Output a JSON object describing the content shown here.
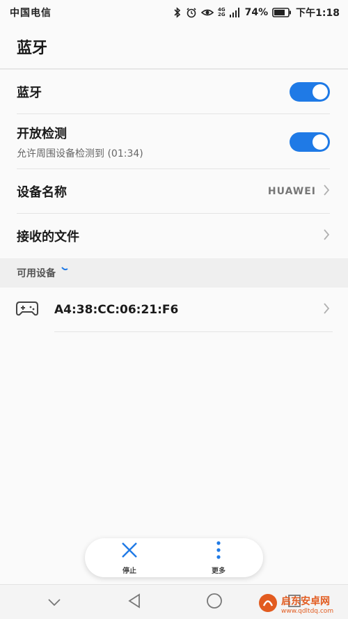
{
  "status_bar": {
    "carrier": "中国电信",
    "net_top": "4G",
    "net_bottom": "2G",
    "battery": "74%",
    "time": "下午1:18"
  },
  "header": {
    "title": "蓝牙"
  },
  "settings": {
    "bluetooth": {
      "label": "蓝牙",
      "enabled": true
    },
    "discoverable": {
      "label": "开放检测",
      "sub": "允许周围设备检测到 (01:34)",
      "enabled": true
    },
    "device_name": {
      "label": "设备名称",
      "value": "HUAWEI"
    },
    "received_files": {
      "label": "接收的文件"
    }
  },
  "available": {
    "section_label": "可用设备",
    "devices": [
      {
        "name": "A4:38:CC:06:21:F6",
        "icon": "gamepad-icon"
      }
    ]
  },
  "actions": {
    "stop": "停止",
    "more": "更多"
  },
  "watermark": {
    "cn": "启东安卓网",
    "url": "www.qdltdq.com"
  },
  "colors": {
    "accent": "#1f7ae6",
    "watermark": "#e25b1f"
  }
}
